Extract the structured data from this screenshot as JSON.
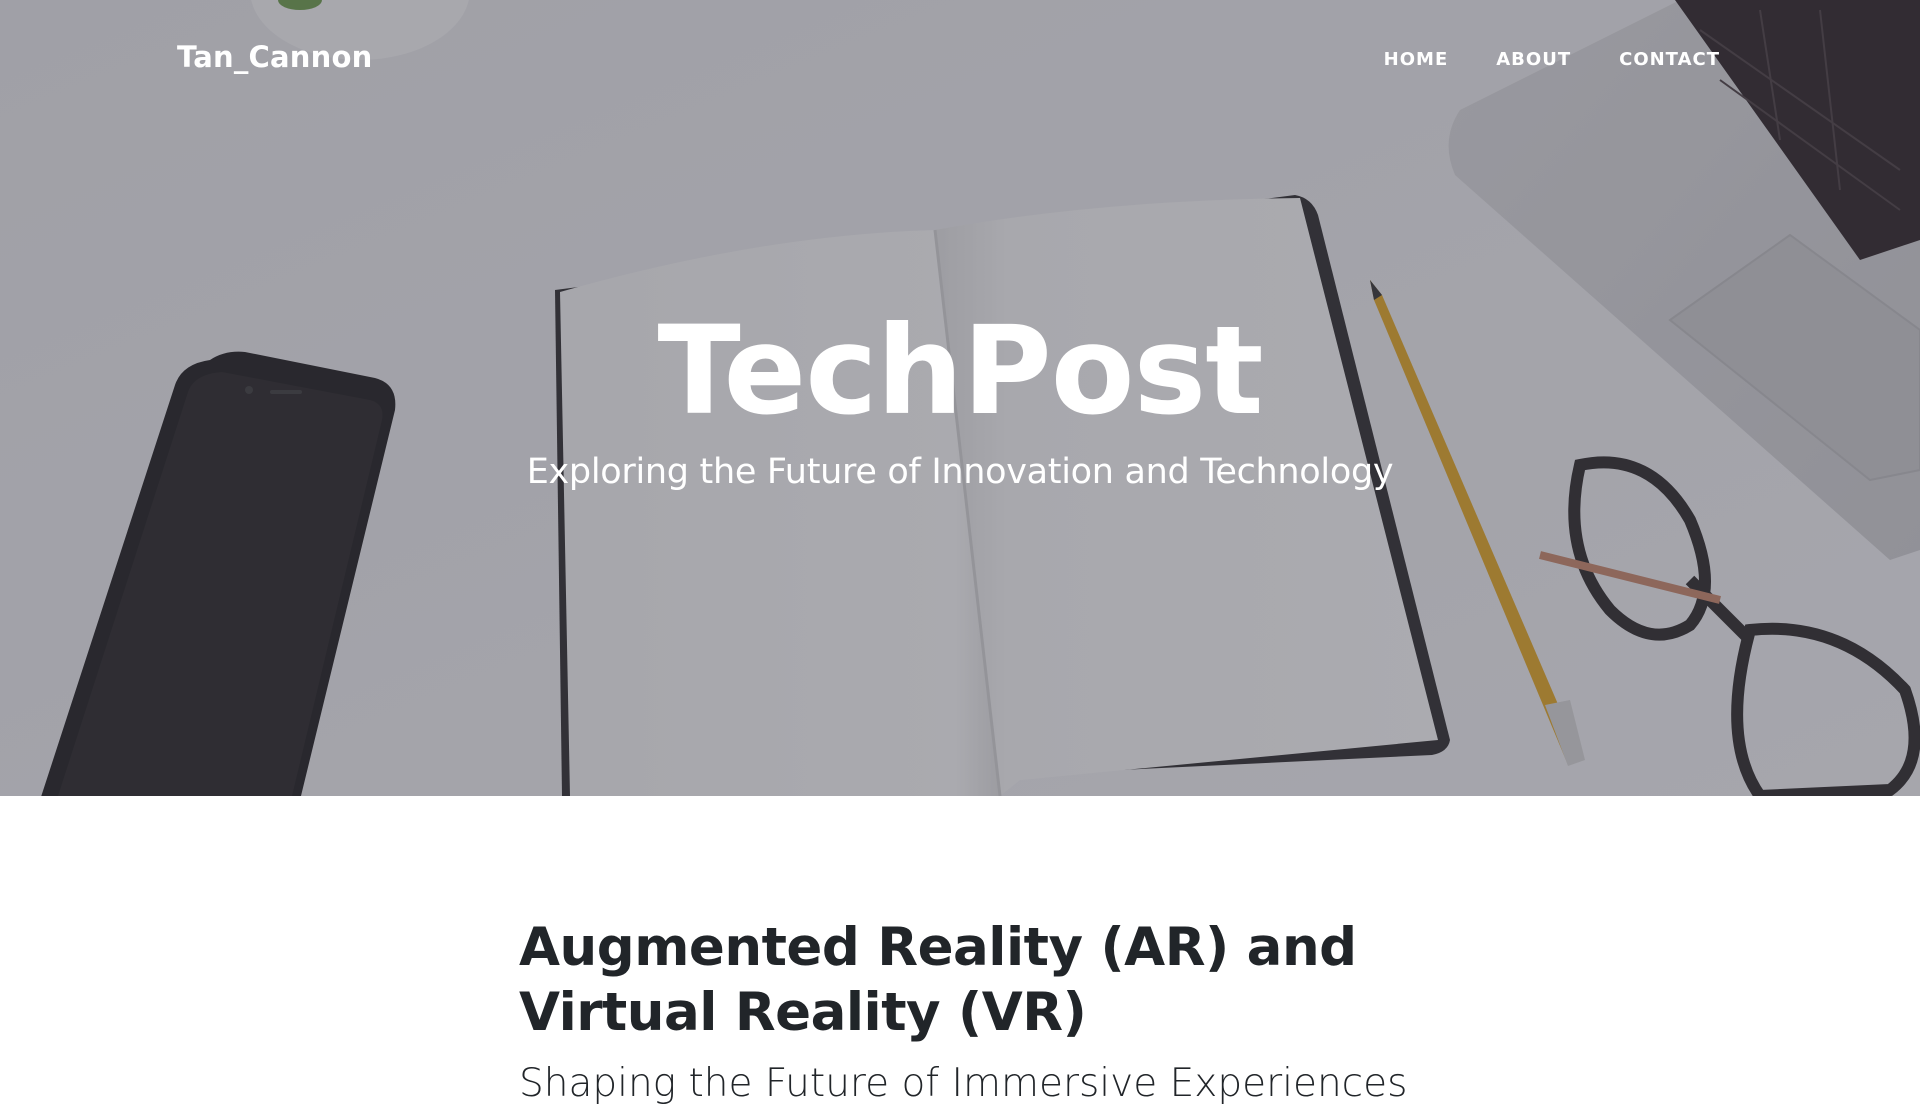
{
  "navbar": {
    "brand": "Tan_Cannon",
    "links": [
      "HOME",
      "ABOUT",
      "CONTACT"
    ]
  },
  "hero": {
    "title": "TechPost",
    "subtitle": "Exploring the Future of Innovation and Technology"
  },
  "post": {
    "title": "Augmented Reality (AR) and Virtual Reality (VR)",
    "subtitle": "Shaping the Future of Immersive Experiences"
  },
  "colors": {
    "hero_overlay": "#5a5b66",
    "text_dark": "#212529",
    "text_light": "#ffffff",
    "pencil": "#e3a722"
  }
}
